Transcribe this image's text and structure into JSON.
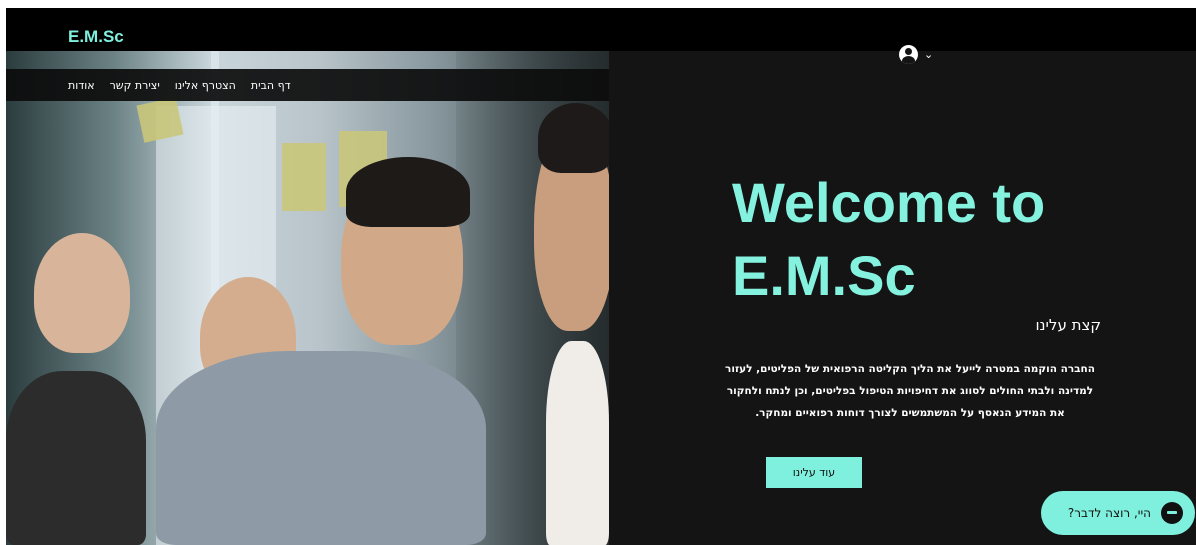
{
  "header": {
    "logo": "E.M.Sc"
  },
  "nav": {
    "items": [
      {
        "label": "אודות"
      },
      {
        "label": "יצירת קשר"
      },
      {
        "label": "הצטרף אלינו"
      },
      {
        "label": "דף הבית"
      }
    ]
  },
  "account": {
    "icon": "user-avatar-icon",
    "chevron": "⌄"
  },
  "hero": {
    "title": "Welcome to E.M.Sc",
    "about_heading": "קצת עלינו",
    "about_text": "החברה הוקמה במטרה לייעל את הליך הקליטה הרפואית של הפליטים, לעזור למדינה ולבתי החולים לסווג את דחיפויות הטיפול בפליטים, וכן לנתח ולחקור את המידע הנאסף על המשתמשים לצורך דוחות רפואיים ומחקר.",
    "button_label": "עוד עלינו"
  },
  "chat": {
    "label": "היי, רוצה לדבר?",
    "icon": "chat-bubble-icon"
  },
  "colors": {
    "accent": "#7ff0dd",
    "background": "#141414",
    "topbar": "#000000"
  }
}
